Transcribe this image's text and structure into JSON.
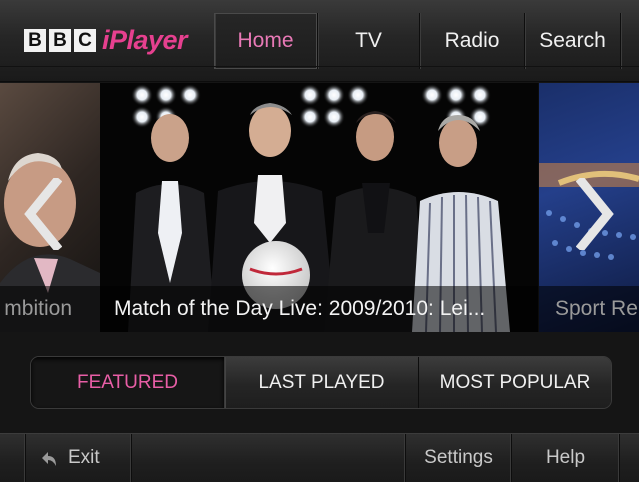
{
  "brand": {
    "bbc_letters": [
      "B",
      "B",
      "C"
    ],
    "iplayer": "iPlayer",
    "accent_color": "#e6408f"
  },
  "nav": {
    "active": "Home",
    "tabs": [
      {
        "label": "Home"
      },
      {
        "label": "TV"
      },
      {
        "label": "Radio"
      },
      {
        "label": "Search"
      }
    ]
  },
  "carousel": {
    "prev_caption": "mbition",
    "current_caption": "Match of the Day Live: 2009/2010: Lei...",
    "next_caption": "Sport Re",
    "prev_icon": "chevron-left-icon",
    "next_icon": "chevron-right-icon"
  },
  "filter": {
    "selected": "FEATURED",
    "tabs": [
      {
        "label": "FEATURED"
      },
      {
        "label": "LAST PLAYED"
      },
      {
        "label": "MOST POPULAR"
      }
    ]
  },
  "footer": {
    "exit_label": "Exit",
    "exit_icon": "back-arrow-icon",
    "settings_label": "Settings",
    "help_label": "Help"
  }
}
